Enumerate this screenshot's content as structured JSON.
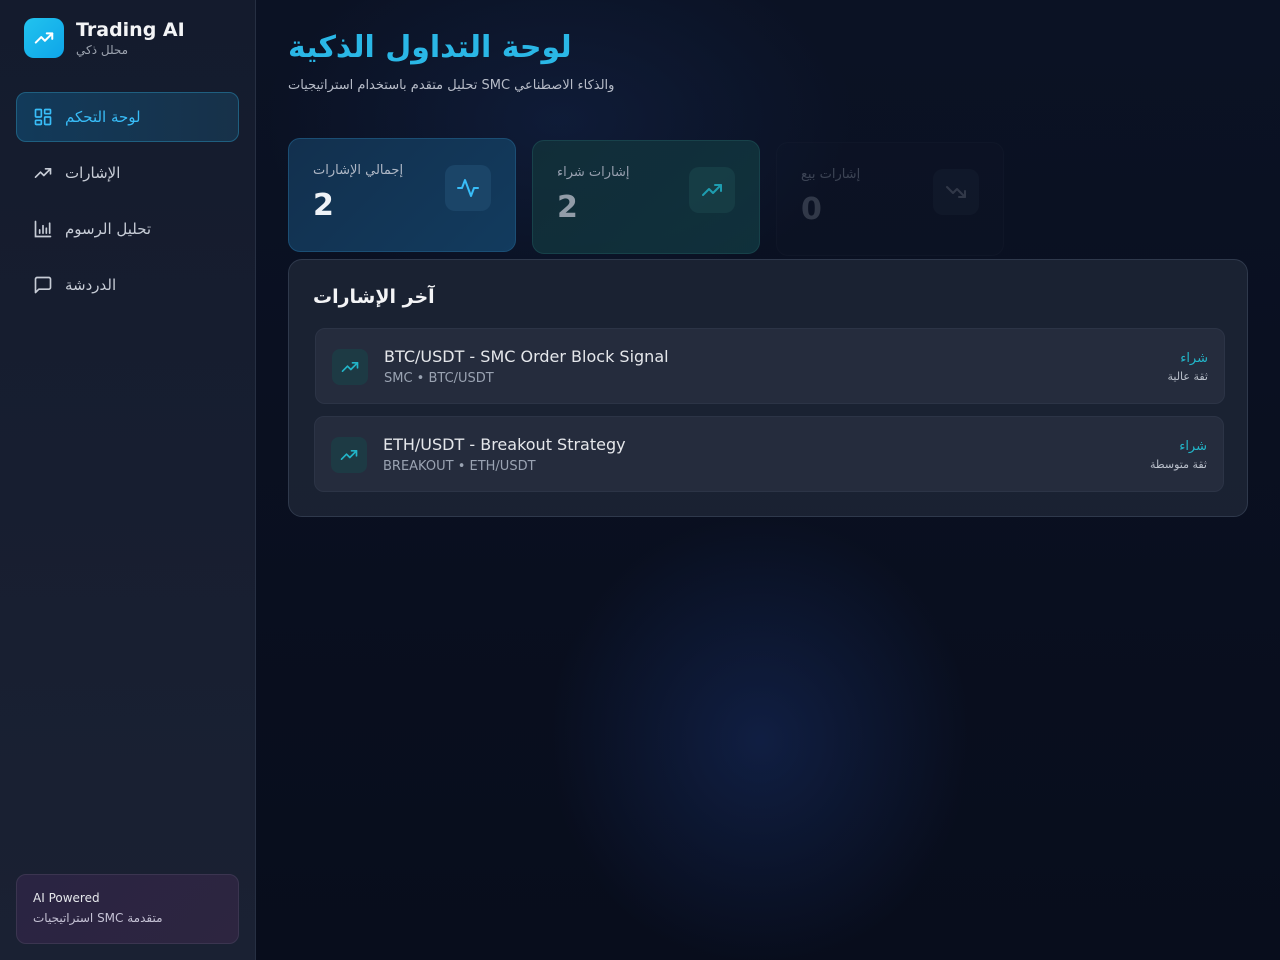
{
  "brand": {
    "title": "Trading AI",
    "subtitle": "محلل ذكي"
  },
  "nav": [
    {
      "label": "لوحة التحكم",
      "icon": "dashboard-icon",
      "active": true
    },
    {
      "label": "الإشارات",
      "icon": "trending-up-icon",
      "active": false
    },
    {
      "label": "تحليل الرسوم",
      "icon": "bar-chart-icon",
      "active": false
    },
    {
      "label": "الدردشة",
      "icon": "chat-icon",
      "active": false
    }
  ],
  "ai_card": {
    "title": "AI Powered",
    "subtitle": "استراتيجيات SMC متقدمة"
  },
  "header": {
    "title": "لوحة التداول الذكية",
    "subtitle": "تحليل متقدم باستخدام استراتيجيات SMC والذكاء الاصطناعي"
  },
  "stats": {
    "total": {
      "label": "إجمالي الإشارات",
      "value": "2",
      "icon": "activity-icon"
    },
    "buy": {
      "label": "إشارات شراء",
      "value": "2",
      "icon": "trending-up-icon"
    },
    "sell": {
      "label": "إشارات بيع",
      "value": "0",
      "icon": "trending-down-icon"
    }
  },
  "recent": {
    "title": "آخر الإشارات",
    "signals": [
      {
        "title": "BTC/USDT - SMC Order Block Signal",
        "meta": "SMC • BTC/USDT",
        "type": "شراء",
        "confidence": "ثقة عالية"
      },
      {
        "title": "ETH/USDT - Breakout Strategy",
        "meta": "BREAKOUT • ETH/USDT",
        "type": "شراء",
        "confidence": "ثقة متوسطة"
      }
    ]
  },
  "colors": {
    "accent": "#22b5c8",
    "brand": "#22c3ee"
  }
}
